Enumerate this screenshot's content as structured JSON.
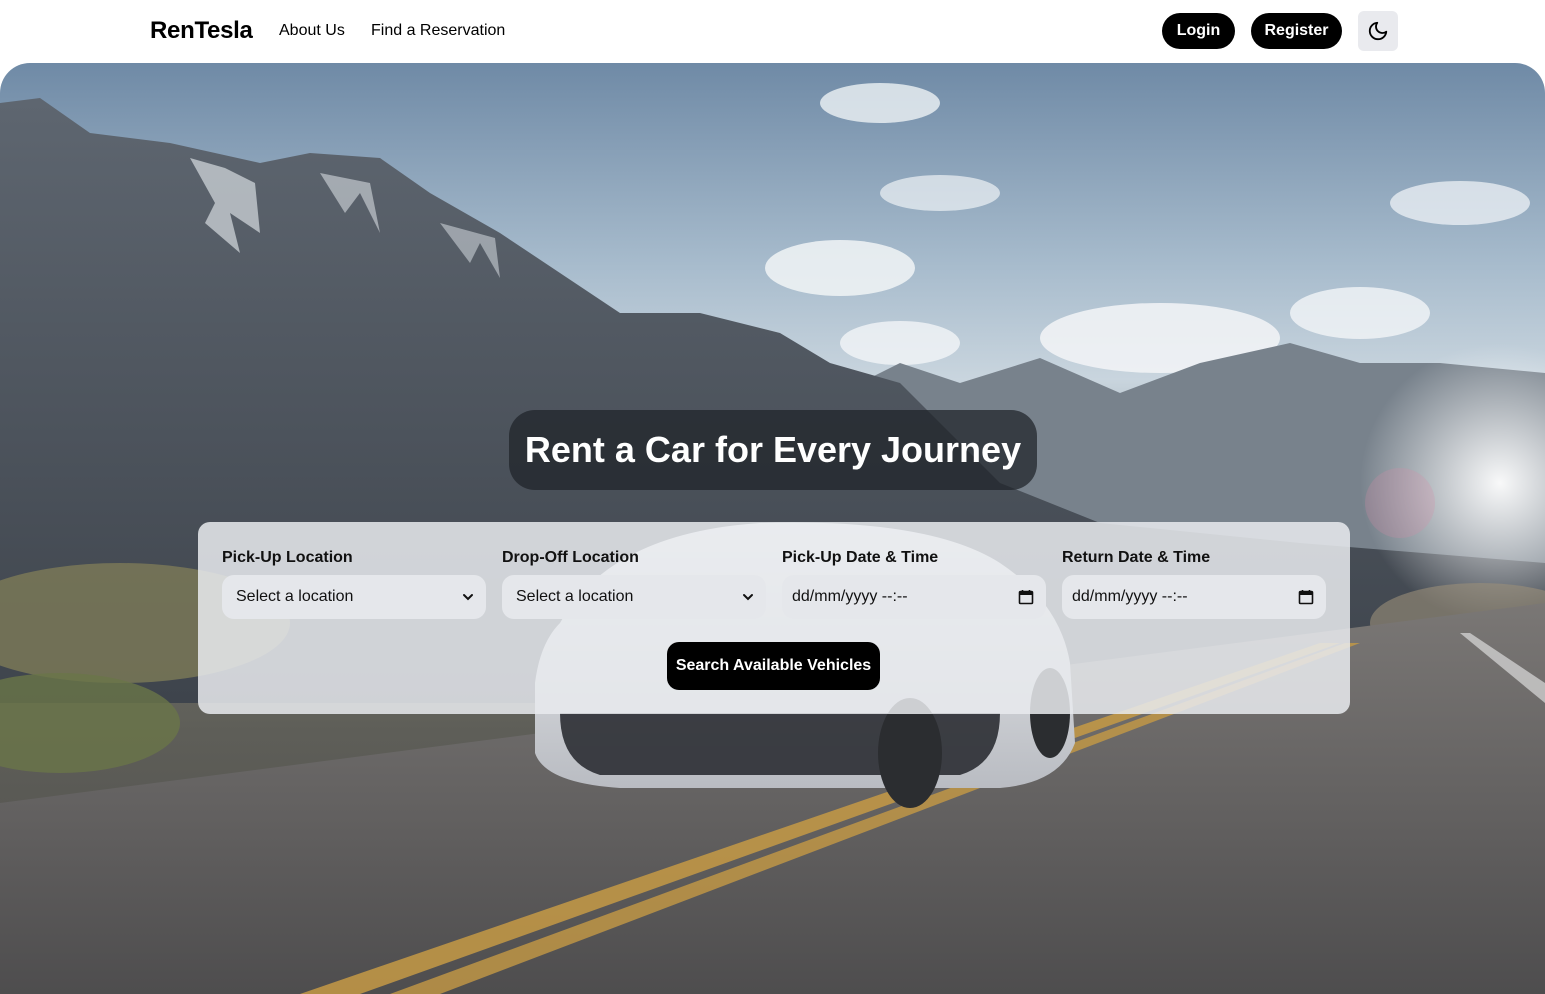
{
  "header": {
    "brand": "RenTesla",
    "nav": {
      "about": "About Us",
      "find_reservation": "Find a Reservation"
    },
    "login_label": "Login",
    "register_label": "Register",
    "theme_toggle_icon": "moon-icon"
  },
  "hero": {
    "headline": "Rent a Car for Every Journey",
    "background_image": "mountain-road-car-photo"
  },
  "search": {
    "pickup_location": {
      "label": "Pick-Up Location",
      "value": "Select a location"
    },
    "dropoff_location": {
      "label": "Drop-Off Location",
      "value": "Select a location"
    },
    "pickup_datetime": {
      "label": "Pick-Up Date & Time",
      "value": "dd/mm/yyyy --:--"
    },
    "return_datetime": {
      "label": "Return Date & Time",
      "value": "dd/mm/yyyy --:--"
    },
    "submit_label": "Search Available Vehicles"
  },
  "colors": {
    "button_bg": "#000000",
    "panel_bg": "#e8eaee",
    "control_bg": "#e5e7eb",
    "headline_box_bg": "#1e2228"
  }
}
